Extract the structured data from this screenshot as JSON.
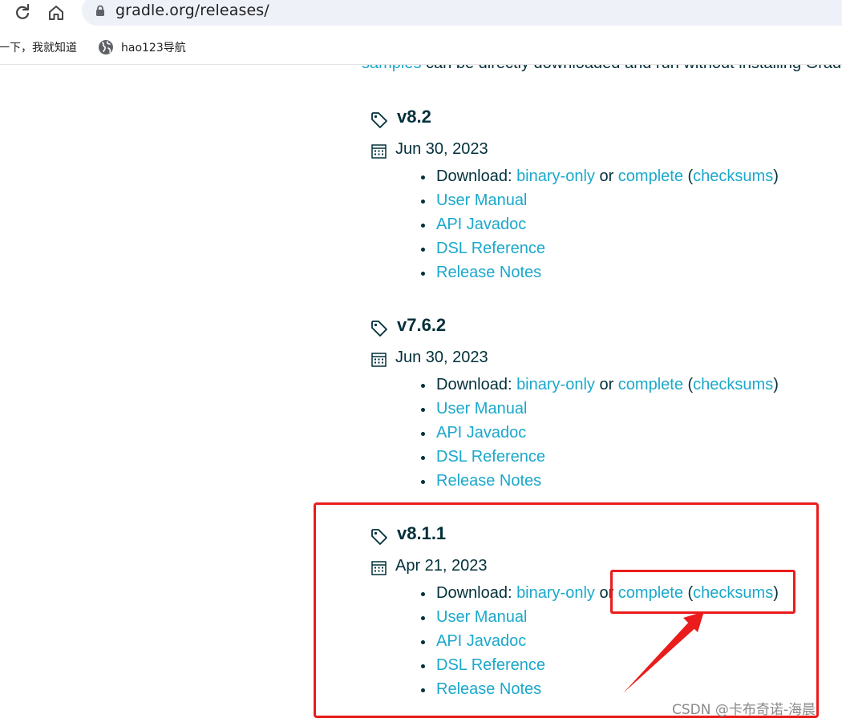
{
  "browser": {
    "url": "gradle.org/releases/",
    "bookmarks": [
      {
        "label": "一下，我就知道"
      },
      {
        "label": "hao123导航"
      }
    ]
  },
  "intro": {
    "link_text": "samples",
    "text": " can be directly downloaded and run without installing Gradle"
  },
  "labels": {
    "download": "Download: ",
    "or": " or ",
    "open_paren": " (",
    "close_paren": ")"
  },
  "releases": [
    {
      "version": "v8.2",
      "date": "Jun 30, 2023",
      "binary": "binary-only",
      "complete": "complete",
      "checksums": "checksums",
      "links": [
        "User Manual",
        "API Javadoc",
        "DSL Reference",
        "Release Notes"
      ]
    },
    {
      "version": "v7.6.2",
      "date": "Jun 30, 2023",
      "binary": "binary-only",
      "complete": "complete",
      "checksums": "checksums",
      "links": [
        "User Manual",
        "API Javadoc",
        "DSL Reference",
        "Release Notes"
      ]
    },
    {
      "version": "v8.1.1",
      "date": "Apr 21, 2023",
      "binary": "binary-only",
      "complete": "complete",
      "checksums": "checksums",
      "links": [
        "User Manual",
        "API Javadoc",
        "DSL Reference",
        "Release Notes"
      ]
    }
  ],
  "watermark": "CSDN @卡布奇诺-海晨",
  "colors": {
    "link": "#1ba8cb",
    "text": "#02303a",
    "annotation": "#ea1c1c"
  }
}
